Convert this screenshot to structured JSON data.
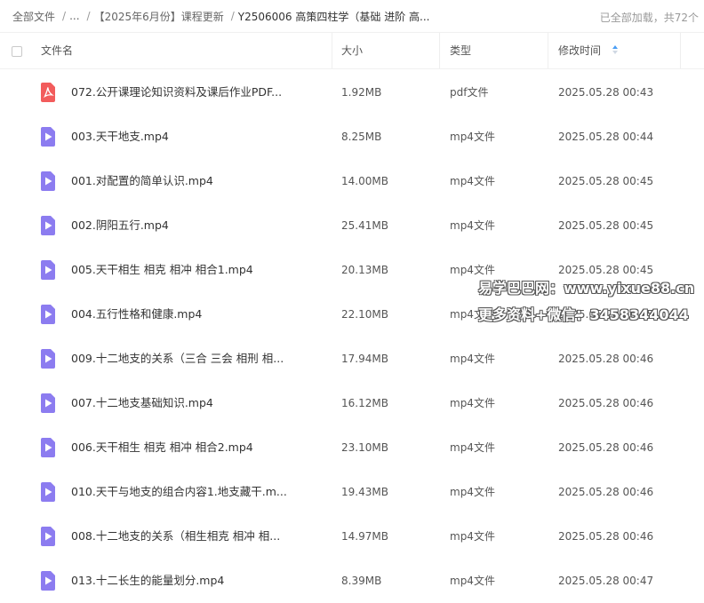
{
  "breadcrumb": {
    "items": [
      "全部文件",
      "...",
      "【2025年6月份】课程更新",
      "Y2506006 高策四柱学（基础 进阶 高..."
    ],
    "separator": "/"
  },
  "status": {
    "loaded_text": "已全部加载，共72个"
  },
  "table": {
    "headers": {
      "name": "文件名",
      "size": "大小",
      "type": "类型",
      "mtime": "修改时间"
    },
    "sort_icon": "sort-caret-icon",
    "rows": [
      {
        "name": "072.公开课理论知识资料及课后作业PDF...",
        "size": "1.92MB",
        "type": "pdf文件",
        "mtime": "2025.05.28 00:43",
        "icon": "pdf-file-icon"
      },
      {
        "name": "003.天干地支.mp4",
        "size": "8.25MB",
        "type": "mp4文件",
        "mtime": "2025.05.28 00:44",
        "icon": "video-file-icon"
      },
      {
        "name": "001.对配置的简单认识.mp4",
        "size": "14.00MB",
        "type": "mp4文件",
        "mtime": "2025.05.28 00:45",
        "icon": "video-file-icon"
      },
      {
        "name": "002.阴阳五行.mp4",
        "size": "25.41MB",
        "type": "mp4文件",
        "mtime": "2025.05.28 00:45",
        "icon": "video-file-icon"
      },
      {
        "name": "005.天干相生 相克 相冲 相合1.mp4",
        "size": "20.13MB",
        "type": "mp4文件",
        "mtime": "2025.05.28 00:45",
        "icon": "video-file-icon"
      },
      {
        "name": "004.五行性格和健康.mp4",
        "size": "22.10MB",
        "type": "mp4文件",
        "mtime": "2025.05.28 00:45",
        "icon": "video-file-icon"
      },
      {
        "name": "009.十二地支的关系（三合 三会 相刑 相...",
        "size": "17.94MB",
        "type": "mp4文件",
        "mtime": "2025.05.28 00:46",
        "icon": "video-file-icon"
      },
      {
        "name": "007.十二地支基础知识.mp4",
        "size": "16.12MB",
        "type": "mp4文件",
        "mtime": "2025.05.28 00:46",
        "icon": "video-file-icon"
      },
      {
        "name": "006.天干相生 相克 相冲 相合2.mp4",
        "size": "23.10MB",
        "type": "mp4文件",
        "mtime": "2025.05.28 00:46",
        "icon": "video-file-icon"
      },
      {
        "name": "010.天干与地支的组合内容1.地支藏干.m...",
        "size": "19.43MB",
        "type": "mp4文件",
        "mtime": "2025.05.28 00:46",
        "icon": "video-file-icon"
      },
      {
        "name": "008.十二地支的关系（相生相克 相冲 相...",
        "size": "14.97MB",
        "type": "mp4文件",
        "mtime": "2025.05.28 00:46",
        "icon": "video-file-icon"
      },
      {
        "name": "013.十二长生的能量划分.mp4",
        "size": "8.39MB",
        "type": "mp4文件",
        "mtime": "2025.05.28 00:47",
        "icon": "video-file-icon"
      }
    ]
  },
  "watermark": {
    "line1": "易学巴巴网：www.yixue88.cn",
    "line2": "更多资料+微信：3458344044"
  },
  "colors": {
    "pdf": "#f25c5c",
    "video": "#8c7cf0",
    "accent": "#4a9ef5"
  }
}
